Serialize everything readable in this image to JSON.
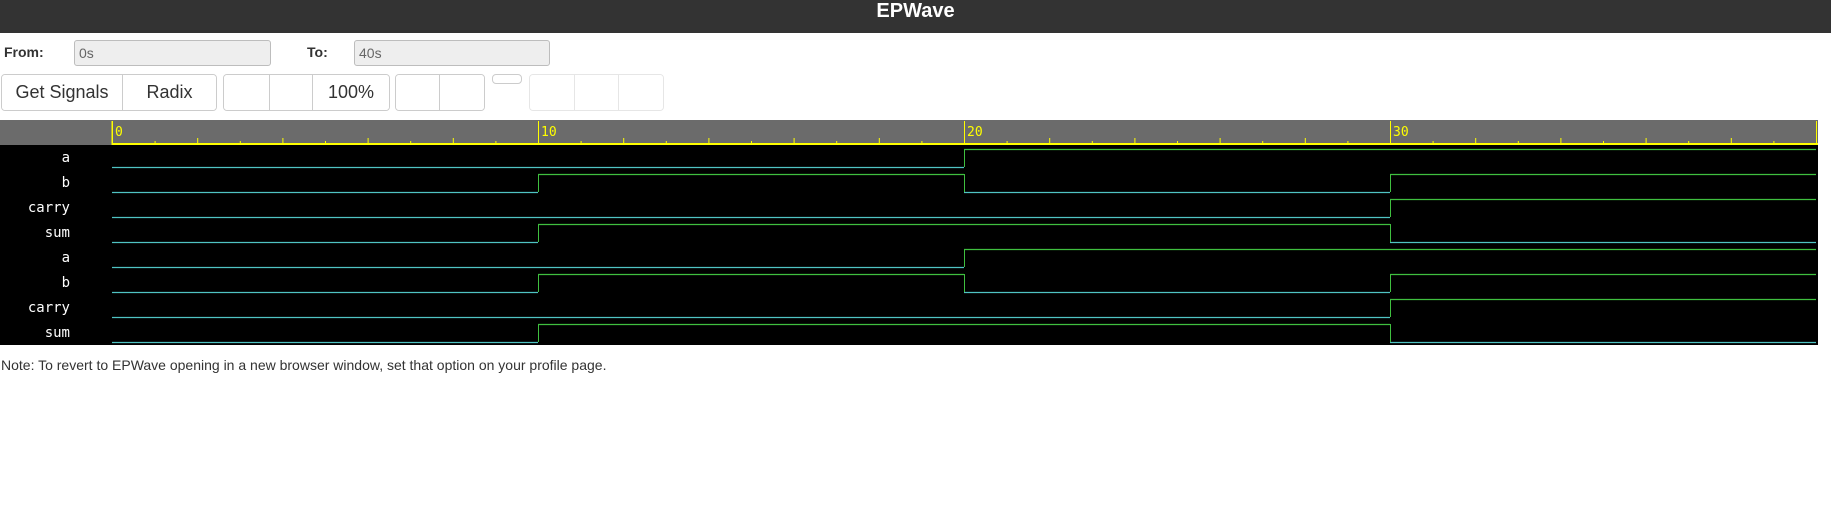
{
  "app": {
    "title": "EPWave"
  },
  "range": {
    "from_label": "From:",
    "from_value": "0s",
    "to_label": "To:",
    "to_value": "40s"
  },
  "toolbar": {
    "get_signals_label": "Get Signals",
    "radix_label": "Radix",
    "zoom_level": "100%"
  },
  "waveform": {
    "time_start": 0,
    "time_end": 40,
    "tick_labels": [
      "0",
      "10",
      "20",
      "30"
    ],
    "signals": [
      {
        "name": "a",
        "transitions": [
          [
            0,
            0
          ],
          [
            20,
            1
          ]
        ]
      },
      {
        "name": "b",
        "transitions": [
          [
            0,
            0
          ],
          [
            10,
            1
          ],
          [
            20,
            0
          ],
          [
            30,
            1
          ]
        ]
      },
      {
        "name": "carry",
        "transitions": [
          [
            0,
            0
          ],
          [
            30,
            1
          ]
        ]
      },
      {
        "name": "sum",
        "transitions": [
          [
            0,
            0
          ],
          [
            10,
            1
          ],
          [
            30,
            0
          ]
        ]
      },
      {
        "name": "a",
        "transitions": [
          [
            0,
            0
          ],
          [
            20,
            1
          ]
        ]
      },
      {
        "name": "b",
        "transitions": [
          [
            0,
            0
          ],
          [
            10,
            1
          ],
          [
            20,
            0
          ],
          [
            30,
            1
          ]
        ]
      },
      {
        "name": "carry",
        "transitions": [
          [
            0,
            0
          ],
          [
            30,
            1
          ]
        ]
      },
      {
        "name": "sum",
        "transitions": [
          [
            0,
            0
          ],
          [
            10,
            1
          ],
          [
            30,
            0
          ]
        ]
      }
    ],
    "colors": {
      "background": "#000000",
      "ruler": "#6b6b6b",
      "ruler_ticks": "#ffff00",
      "trace_low": "#4fc3c3",
      "trace_high": "#3fbf3f",
      "label_text": "#ffffff"
    }
  },
  "note": "Note: To revert to EPWave opening in a new browser window, set that option on your profile page."
}
